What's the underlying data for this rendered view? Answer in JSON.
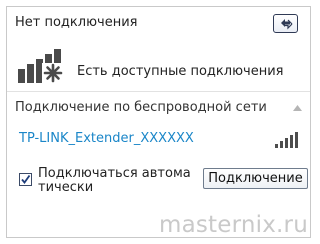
{
  "header": {
    "title": "Нет подключения",
    "refresh_icon": "network-refresh-icon"
  },
  "status": {
    "icon": "signal-bars-star-icon",
    "text": "Есть доступные подключения"
  },
  "wireless_section": {
    "title": "Подключение по беспроводной сети",
    "collapse_icon": "caret-up-icon"
  },
  "network": {
    "ssid": "TP-LINK_Extender_XXXXXX",
    "signal_icon": "signal-strength-icon",
    "signal_level": 1.0
  },
  "auto_connect": {
    "label": "Подключаться автома тически",
    "checked": true
  },
  "connect_button": {
    "label": "Подключение"
  },
  "watermark": "masternix.ru",
  "colors": {
    "ssid": "#1a86c8",
    "border": "#c9c9c9",
    "watermark": "#c9c9c9"
  }
}
